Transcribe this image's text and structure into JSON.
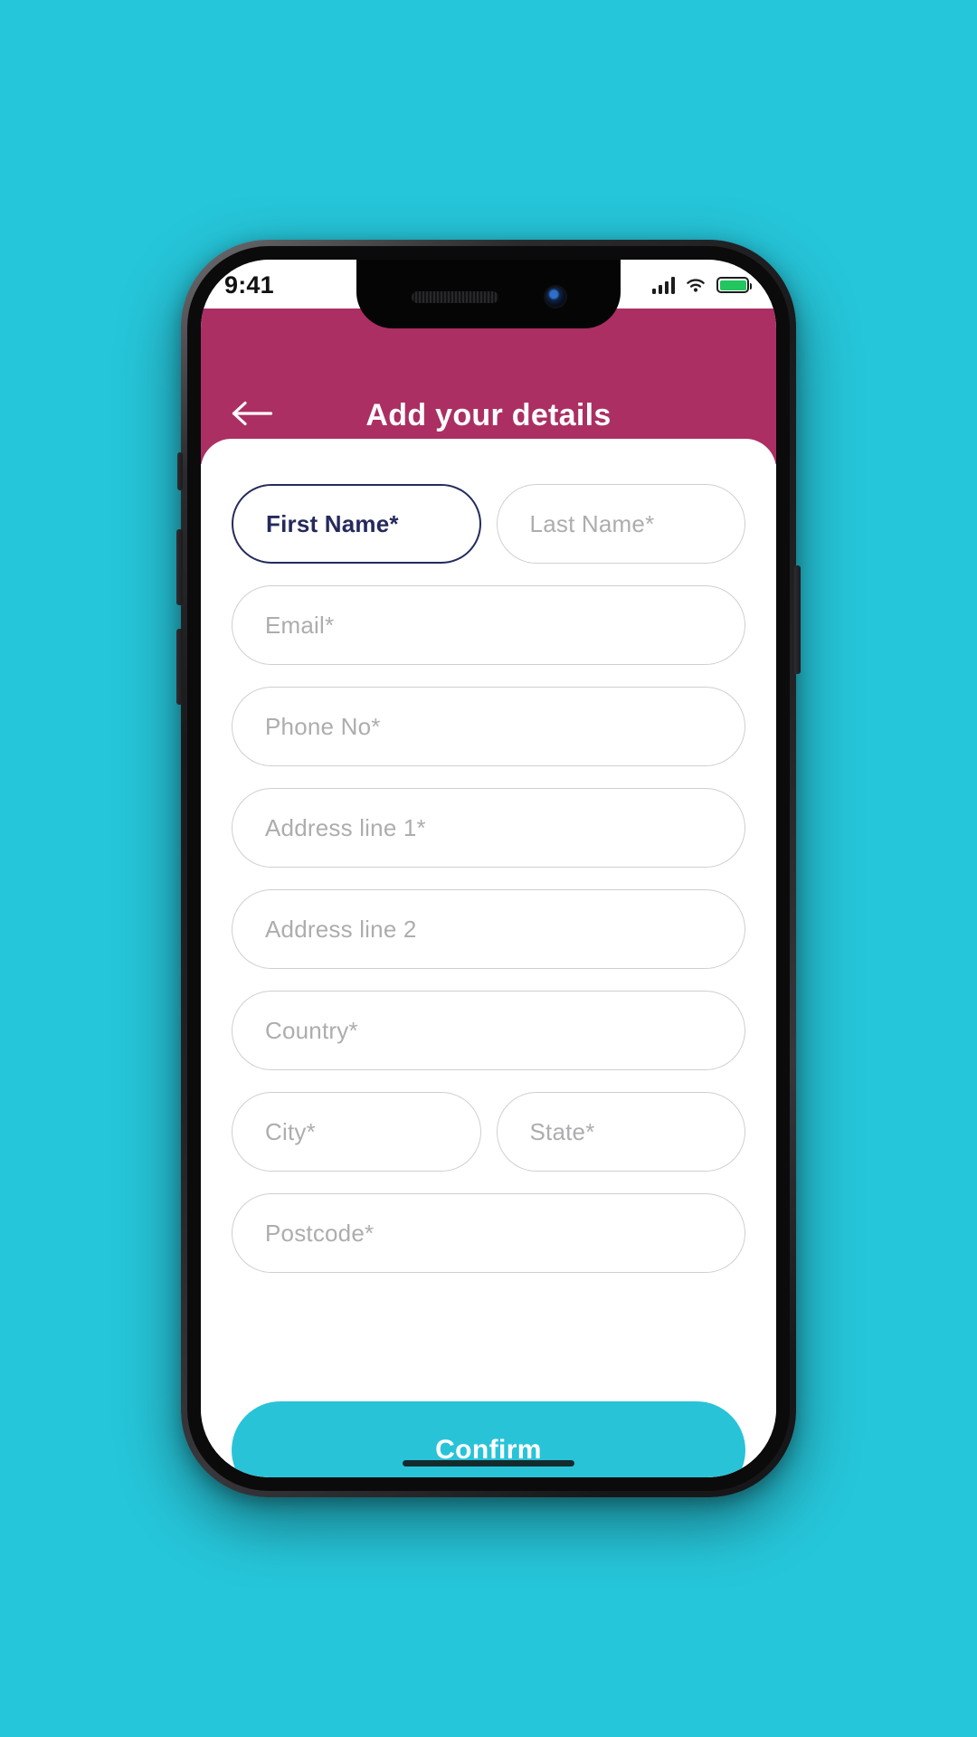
{
  "theme": {
    "page_background": "#26c6da",
    "header_color": "#ab2f63",
    "accent_color": "#29c3d8",
    "focus_color": "#252a5c",
    "placeholder_color": "#adadb0",
    "battery_color": "#22c55e"
  },
  "status_bar": {
    "time": "9:41",
    "signal_icon": "cellular-signal-icon",
    "wifi_icon": "wifi-icon",
    "battery_icon": "battery-full-icon"
  },
  "header": {
    "back_icon": "arrow-left-icon",
    "title": "Add your details"
  },
  "form": {
    "rows": [
      {
        "type": "pair",
        "fields": [
          {
            "name": "first-name",
            "label": "First Name*",
            "value": "",
            "focused": true,
            "required": true
          },
          {
            "name": "last-name",
            "label": "Last Name*",
            "value": "",
            "focused": false,
            "required": true
          }
        ]
      },
      {
        "type": "single",
        "fields": [
          {
            "name": "email",
            "label": "Email*",
            "value": "",
            "focused": false,
            "required": true
          }
        ]
      },
      {
        "type": "single",
        "fields": [
          {
            "name": "phone",
            "label": "Phone No*",
            "value": "",
            "focused": false,
            "required": true
          }
        ]
      },
      {
        "type": "single",
        "fields": [
          {
            "name": "address-line-1",
            "label": "Address line 1*",
            "value": "",
            "focused": false,
            "required": true
          }
        ]
      },
      {
        "type": "single",
        "fields": [
          {
            "name": "address-line-2",
            "label": "Address line 2",
            "value": "",
            "focused": false,
            "required": false
          }
        ]
      },
      {
        "type": "single",
        "fields": [
          {
            "name": "country",
            "label": "Country*",
            "value": "",
            "focused": false,
            "required": true
          }
        ]
      },
      {
        "type": "pair",
        "fields": [
          {
            "name": "city",
            "label": "City*",
            "value": "",
            "focused": false,
            "required": true
          },
          {
            "name": "state",
            "label": "State*",
            "value": "",
            "focused": false,
            "required": true
          }
        ]
      },
      {
        "type": "single",
        "fields": [
          {
            "name": "postcode",
            "label": "Postcode*",
            "value": "",
            "focused": false,
            "required": true
          }
        ]
      }
    ]
  },
  "footer": {
    "confirm_label": "Confirm"
  }
}
